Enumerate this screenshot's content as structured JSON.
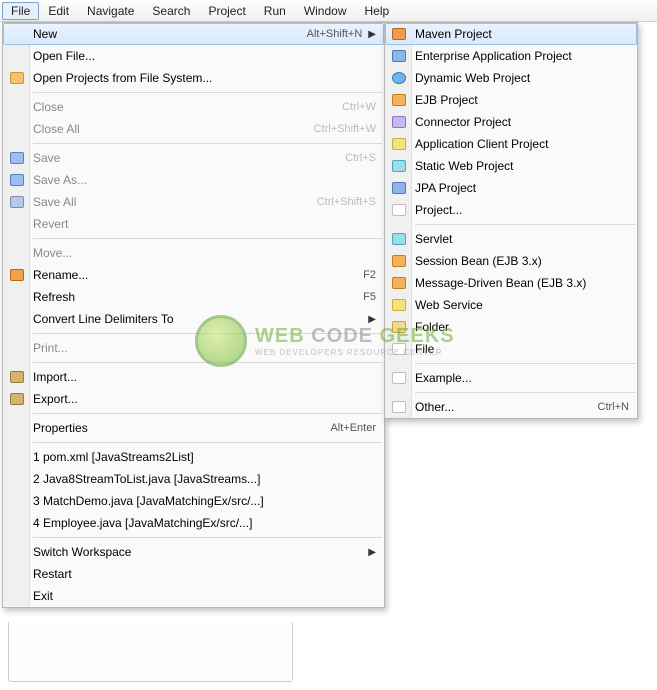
{
  "menubar": [
    "File",
    "Edit",
    "Navigate",
    "Search",
    "Project",
    "Run",
    "Window",
    "Help"
  ],
  "fileMenu": {
    "groups": [
      [
        {
          "label": "New",
          "shortcut": "Alt+Shift+N",
          "arrow": true,
          "hl": true,
          "name": "file-new"
        },
        {
          "label": "Open File...",
          "name": "file-open-file"
        },
        {
          "label": "Open Projects from File System...",
          "icon": "sq-folder",
          "name": "file-open-projects"
        }
      ],
      [
        {
          "label": "Close",
          "shortcut": "Ctrl+W",
          "dim": true,
          "name": "file-close"
        },
        {
          "label": "Close All",
          "shortcut": "Ctrl+Shift+W",
          "dim": true,
          "name": "file-close-all"
        }
      ],
      [
        {
          "label": "Save",
          "shortcut": "Ctrl+S",
          "dim": true,
          "icon": "sq-save",
          "name": "file-save"
        },
        {
          "label": "Save As...",
          "dim": true,
          "icon": "sq-save",
          "name": "file-save-as"
        },
        {
          "label": "Save All",
          "shortcut": "Ctrl+Shift+S",
          "dim": true,
          "icon": "sq-saveall",
          "name": "file-save-all"
        },
        {
          "label": "Revert",
          "dim": true,
          "name": "file-revert"
        }
      ],
      [
        {
          "label": "Move...",
          "dim": true,
          "name": "file-move"
        },
        {
          "label": "Rename...",
          "shortcut": "F2",
          "icon": "sq-pen",
          "name": "file-rename"
        },
        {
          "label": "Refresh",
          "shortcut": "F5",
          "name": "file-refresh"
        },
        {
          "label": "Convert Line Delimiters To",
          "arrow": true,
          "name": "file-convert-line"
        }
      ],
      [
        {
          "label": "Print...",
          "dim": true,
          "name": "file-print"
        }
      ],
      [
        {
          "label": "Import...",
          "icon": "sq-exp",
          "name": "file-import"
        },
        {
          "label": "Export...",
          "icon": "sq-exp",
          "name": "file-export"
        }
      ],
      [
        {
          "label": "Properties",
          "shortcut": "Alt+Enter",
          "name": "file-properties"
        }
      ],
      [
        {
          "label": "1 pom.xml  [JavaStreams2List]",
          "name": "file-recent-1"
        },
        {
          "label": "2 Java8StreamToList.java  [JavaStreams...]",
          "name": "file-recent-2"
        },
        {
          "label": "3 MatchDemo.java  [JavaMatchingEx/src/...]",
          "name": "file-recent-3"
        },
        {
          "label": "4 Employee.java  [JavaMatchingEx/src/...]",
          "name": "file-recent-4"
        }
      ],
      [
        {
          "label": "Switch Workspace",
          "arrow": true,
          "name": "file-switch-ws"
        },
        {
          "label": "Restart",
          "name": "file-restart"
        },
        {
          "label": "Exit",
          "name": "file-exit"
        }
      ]
    ]
  },
  "newMenu": {
    "groups": [
      [
        {
          "label": "Maven Project",
          "icon": "sq-m",
          "hl": true,
          "name": "new-maven-project"
        },
        {
          "label": "Enterprise Application Project",
          "icon": "sq-blue",
          "name": "new-ear-project"
        },
        {
          "label": "Dynamic Web Project",
          "icon": "sq-globe",
          "name": "new-dynamic-web"
        },
        {
          "label": "EJB Project",
          "icon": "sq-orange",
          "name": "new-ejb-project"
        },
        {
          "label": "Connector Project",
          "icon": "sq-lav",
          "name": "new-connector-project"
        },
        {
          "label": "Application Client Project",
          "icon": "sq-yel",
          "name": "new-app-client"
        },
        {
          "label": "Static Web Project",
          "icon": "sq-cyan",
          "name": "new-static-web"
        },
        {
          "label": "JPA Project",
          "icon": "sq-blue",
          "name": "new-jpa-project"
        },
        {
          "label": "Project...",
          "icon": "sq-plain",
          "name": "new-project"
        }
      ],
      [
        {
          "label": "Servlet",
          "icon": "sq-cyan",
          "name": "new-servlet"
        },
        {
          "label": "Session Bean (EJB 3.x)",
          "icon": "sq-orange",
          "name": "new-session-bean"
        },
        {
          "label": "Message-Driven Bean (EJB 3.x)",
          "icon": "sq-orange",
          "name": "new-mdb"
        },
        {
          "label": "Web Service",
          "icon": "sq-yel",
          "name": "new-web-service"
        },
        {
          "label": "Folder",
          "icon": "sq-foldery",
          "name": "new-folder"
        },
        {
          "label": "File",
          "icon": "sq-plain",
          "name": "new-file"
        }
      ],
      [
        {
          "label": "Example...",
          "icon": "sq-plain",
          "name": "new-example"
        }
      ],
      [
        {
          "label": "Other...",
          "shortcut": "Ctrl+N",
          "icon": "sq-plain",
          "name": "new-other"
        }
      ]
    ]
  },
  "watermark": {
    "line1a": "WEB",
    "line1b": "CODE",
    "line1c": "GEEKS",
    "line2": "WEB DEVELOPERS RESOURCE CENTER"
  }
}
